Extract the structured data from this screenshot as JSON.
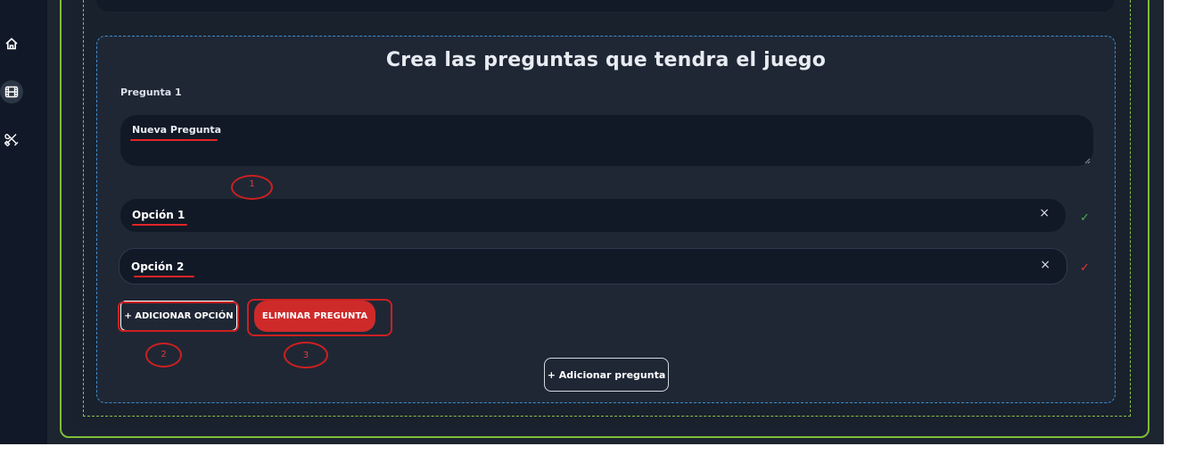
{
  "sidebar": {
    "icons": [
      "home-icon",
      "film-icon",
      "tools-icon"
    ],
    "active": "film-icon"
  },
  "question_card": {
    "title": "Crea las preguntas que tendra el juego",
    "question_label": "Pregunta 1",
    "question_value": "Nueva Pregunta",
    "options": [
      {
        "label": "Opción 1",
        "remove": "×",
        "check": "✓",
        "check_color": "#4caf50"
      },
      {
        "label": "Opción 2",
        "remove": "×",
        "check": "✓",
        "check_color": "#e53935"
      }
    ],
    "add_option_button": "+ ADICIONAR OPCIÓN",
    "delete_question_button": "ELIMINAR PREGUNTA",
    "add_question_button": "+ Adicionar pregunta"
  },
  "annotations": [
    "1",
    "2",
    "3"
  ],
  "colors": {
    "background": "#1d2531",
    "sidebar": "#111827",
    "frame_green": "#7ebd37",
    "card_border": "#3e8ecf",
    "danger": "#cf2a2a",
    "annotation": "#cc2020"
  }
}
